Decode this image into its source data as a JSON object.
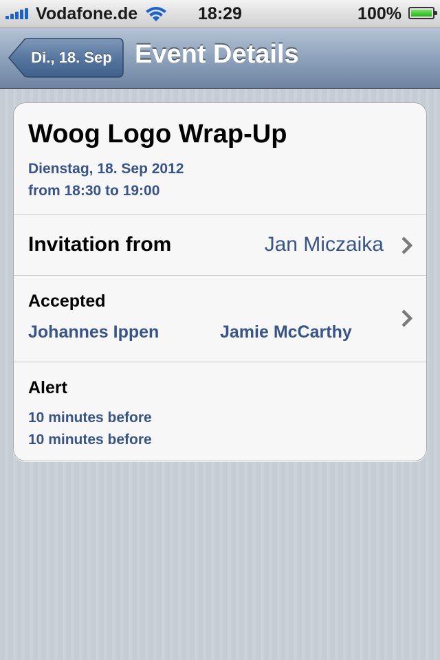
{
  "status_bar": {
    "carrier": "Vodafone.de",
    "time": "18:29",
    "battery": "100%",
    "signal_icon": "signal-bars-icon",
    "wifi_icon": "wifi-icon",
    "battery_icon": "battery-icon"
  },
  "nav": {
    "back_label": "Di., 18. Sep",
    "title": "Event Details"
  },
  "event": {
    "title": "Woog Logo Wrap-Up",
    "date": "Dienstag, 18. Sep 2012",
    "time_range": "from 18:30 to 19:00"
  },
  "invitation": {
    "label": "Invitation from",
    "value": "Jan Miczaika"
  },
  "accepted": {
    "label": "Accepted",
    "attendees": [
      "Johannes Ippen",
      "Jamie McCarthy"
    ]
  },
  "alert": {
    "label": "Alert",
    "values": [
      "10 minutes before",
      "10 minutes before"
    ]
  },
  "colors": {
    "accent_blue": "#385487",
    "nav_bar": "#8ea2bb",
    "background": "#c5ccd4"
  }
}
